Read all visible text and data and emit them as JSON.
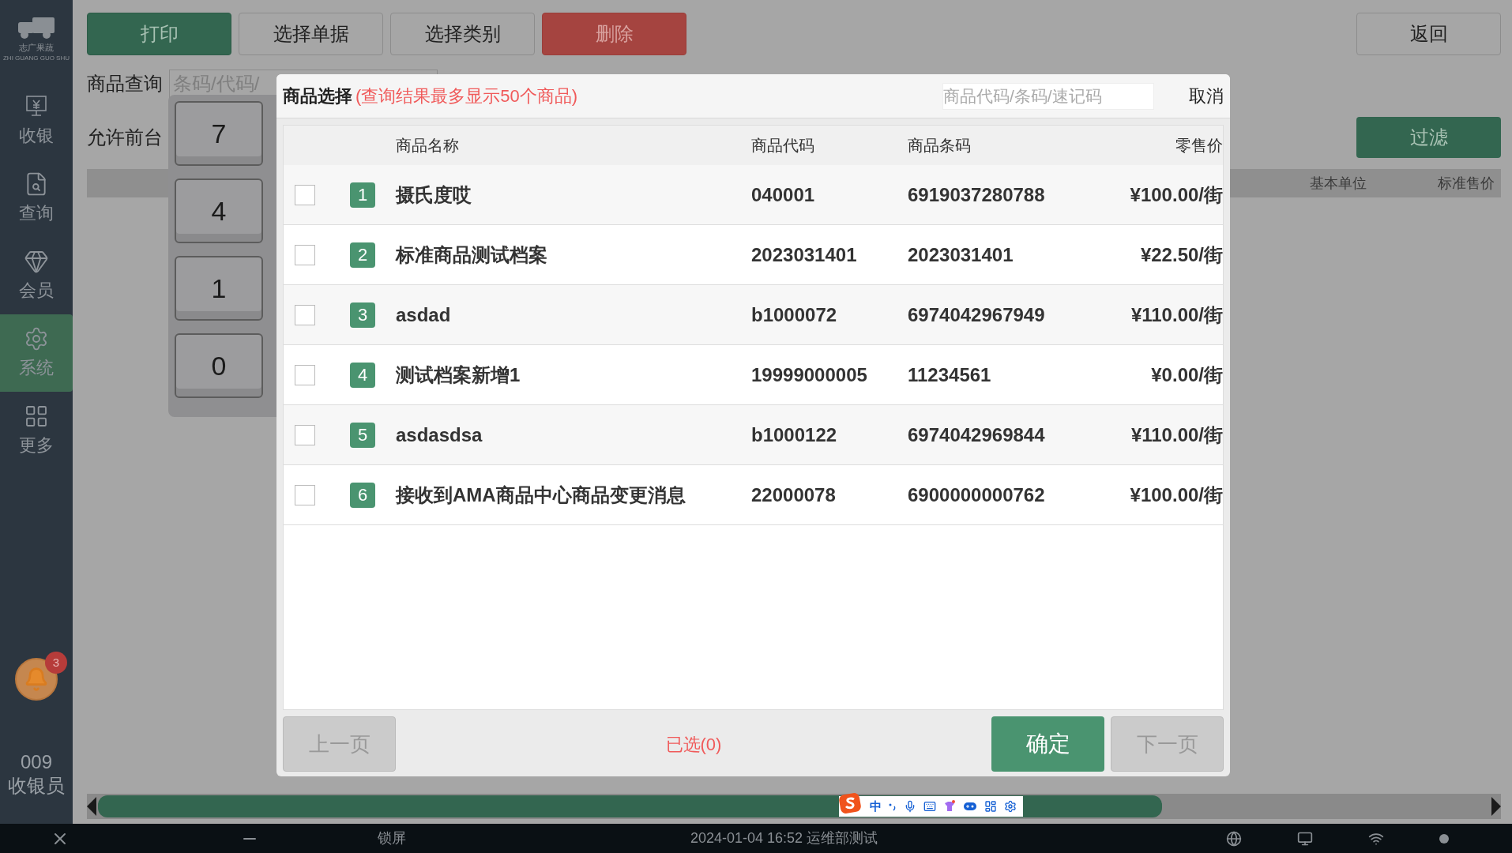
{
  "sidebar": {
    "logo_text": "志广果蔬",
    "logo_subtext": "ZHI GUANG GUO SHU",
    "items": [
      {
        "label": "收银",
        "selected": false
      },
      {
        "label": "查询",
        "selected": false
      },
      {
        "label": "会员",
        "selected": false
      },
      {
        "label": "系统",
        "selected": true
      },
      {
        "label": "更多",
        "selected": false
      }
    ],
    "notification_count": "3",
    "user_id": "009",
    "user_role": "收银员"
  },
  "toolbar": [
    {
      "label": "打印",
      "kind": "primary"
    },
    {
      "label": "选择单据",
      "kind": "plain"
    },
    {
      "label": "选择类别",
      "kind": "plain"
    },
    {
      "label": "删除",
      "kind": "danger"
    }
  ],
  "back_button": "返回",
  "query": {
    "label": "商品查询",
    "placeholder": "条码/代码/"
  },
  "filter_label": "允许前台",
  "filter_button": "过滤",
  "bg_table_columns": [
    "基本单位",
    "标准售价"
  ],
  "keypad": [
    "7",
    "4",
    "1",
    "0"
  ],
  "dialog": {
    "title": "商品选择",
    "note": "(查询结果最多显示50个商品)",
    "search_placeholder": "商品代码/条码/速记码",
    "cancel": "取消",
    "columns": [
      "商品名称",
      "商品代码",
      "商品条码",
      "零售价"
    ],
    "rows": [
      {
        "index": "1",
        "name": "摄氏度哎",
        "code": "040001",
        "barcode": "6919037280788",
        "price": "¥100.00/街",
        "checked": false
      },
      {
        "index": "2",
        "name": "标准商品测试档案",
        "code": "2023031401",
        "barcode": "2023031401",
        "price": "¥22.50/街",
        "checked": false
      },
      {
        "index": "3",
        "name": "asdad",
        "code": "b1000072",
        "barcode": "6974042967949",
        "price": "¥110.00/街",
        "checked": false
      },
      {
        "index": "4",
        "name": "测试档案新增1",
        "code": "19999000005",
        "barcode": "11234561",
        "price": "¥0.00/街",
        "checked": false
      },
      {
        "index": "5",
        "name": "asdasdsa",
        "code": "b1000122",
        "barcode": "6974042969844",
        "price": "¥110.00/街",
        "checked": false
      },
      {
        "index": "6",
        "name": "接收到AMA商品中心商品变更消息",
        "code": "22000078",
        "barcode": "6900000000762",
        "price": "¥100.00/街",
        "checked": false
      }
    ],
    "prev_button": {
      "label": "上一页",
      "disabled": true
    },
    "selected_count": "已选(0)",
    "confirm_button": "确定",
    "next_button": {
      "label": "下一页",
      "disabled": true
    }
  },
  "ime": {
    "mode": "中"
  },
  "taskbar": {
    "lock": "锁屏",
    "status": "2024-01-04 16:52 运维部测试"
  }
}
